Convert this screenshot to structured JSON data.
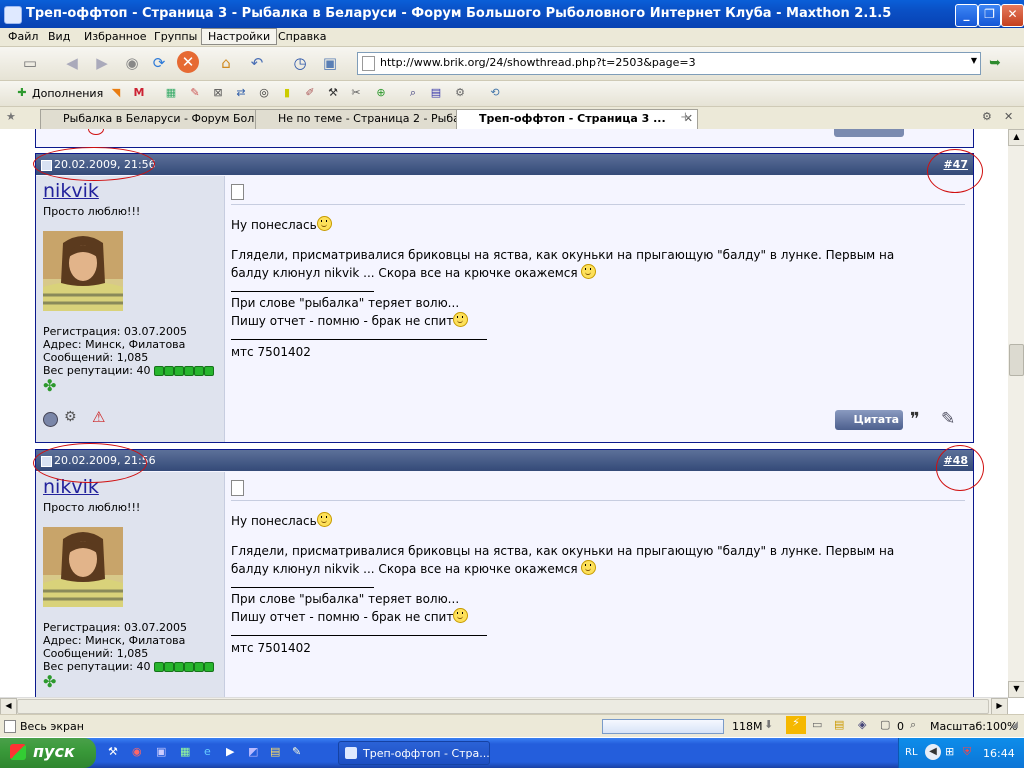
{
  "window": {
    "title": "Треп-оффтоп - Страница 3 - Рыбалка в Беларуси - Форум Большого Рыболовного Интернет Клуба - Maxthon 2.1.5",
    "controls": [
      "minimize",
      "maximize",
      "close"
    ]
  },
  "menu": [
    "Файл",
    "Вид",
    "Избранное",
    "Группы",
    "Настройки",
    "Справка"
  ],
  "menu_active": "Настройки",
  "address": {
    "url": "http://www.brik.org/24/showthread.php?t=2503&page=3"
  },
  "toolbar2": {
    "addons_label": "Дополнения"
  },
  "tabs": [
    {
      "label": "Рыбалка в Беларуси - Форум Боль...",
      "active": false
    },
    {
      "label": "Не по теме - Страница 2 - Рыбалк...",
      "active": false
    },
    {
      "label": "Треп-оффтоп - Страница 3 ...",
      "active": true
    }
  ],
  "quote_label": "Цитата",
  "posts": [
    {
      "date": "20.02.2009, 21:56",
      "number": "#47",
      "username": "nikvik",
      "user_title": "Просто люблю!!!",
      "registration": "Регистрация: 03.07.2005",
      "address": "Адрес: Минск, Филатова",
      "messages": "Сообщений: 1,085",
      "reputation": "Вес репутации: 40",
      "text1": "Ну понеслась",
      "text2": "Глядели, присматривалися бриковцы на яства, как окуньки на прыгающую \"балду\" в лунке. Первым на",
      "text3": "балду клюнул nikvik ... Скора все на крючке окажемся",
      "sig1": "При слове \"рыбалка\" теряет волю...",
      "sig2": "Пишу отчет - помню - брак не спит",
      "sig3": "мтс 7501402"
    },
    {
      "date": "20.02.2009, 21:56",
      "number": "#48",
      "username": "nikvik",
      "user_title": "Просто люблю!!!",
      "registration": "Регистрация: 03.07.2005",
      "address": "Адрес: Минск, Филатова",
      "messages": "Сообщений: 1,085",
      "reputation": "Вес репутации: 40",
      "text1": "Ну понеслась",
      "text2": "Глядели, присматривалися бриковцы на яства, как окуньки на прыгающую \"балду\" в лунке. Первым на",
      "text3": "балду клюнул nikvik ... Скора все на крючке окажемся",
      "sig1": "При слове \"рыбалка\" теряет волю...",
      "sig2": "Пишу отчет - помню - брак не спит",
      "sig3": "мтс 7501402"
    }
  ],
  "status": {
    "left": "Весь экран",
    "memory": "118M",
    "count": "0",
    "zoom": "Масштаб:100%"
  },
  "taskbar": {
    "start": "пуск",
    "task": "Треп-оффтоп - Стра...",
    "lang": "RL",
    "clock": "16:44"
  },
  "colors": {
    "post_header": "#344a78",
    "username": "#22229c",
    "annotation": "#d01010"
  }
}
